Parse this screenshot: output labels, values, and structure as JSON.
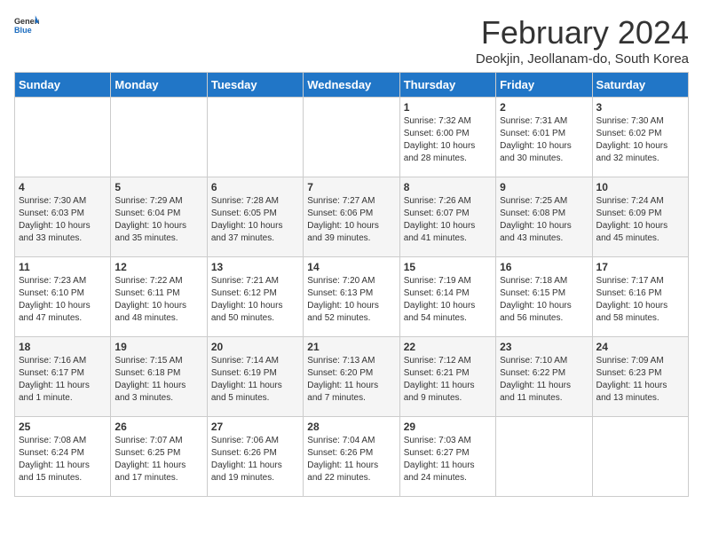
{
  "header": {
    "logo_general": "General",
    "logo_blue": "Blue",
    "month_title": "February 2024",
    "subtitle": "Deokjin, Jeollanam-do, South Korea"
  },
  "weekdays": [
    "Sunday",
    "Monday",
    "Tuesday",
    "Wednesday",
    "Thursday",
    "Friday",
    "Saturday"
  ],
  "weeks": [
    [
      {
        "day": "",
        "info": ""
      },
      {
        "day": "",
        "info": ""
      },
      {
        "day": "",
        "info": ""
      },
      {
        "day": "",
        "info": ""
      },
      {
        "day": "1",
        "info": "Sunrise: 7:32 AM\nSunset: 6:00 PM\nDaylight: 10 hours\nand 28 minutes."
      },
      {
        "day": "2",
        "info": "Sunrise: 7:31 AM\nSunset: 6:01 PM\nDaylight: 10 hours\nand 30 minutes."
      },
      {
        "day": "3",
        "info": "Sunrise: 7:30 AM\nSunset: 6:02 PM\nDaylight: 10 hours\nand 32 minutes."
      }
    ],
    [
      {
        "day": "4",
        "info": "Sunrise: 7:30 AM\nSunset: 6:03 PM\nDaylight: 10 hours\nand 33 minutes."
      },
      {
        "day": "5",
        "info": "Sunrise: 7:29 AM\nSunset: 6:04 PM\nDaylight: 10 hours\nand 35 minutes."
      },
      {
        "day": "6",
        "info": "Sunrise: 7:28 AM\nSunset: 6:05 PM\nDaylight: 10 hours\nand 37 minutes."
      },
      {
        "day": "7",
        "info": "Sunrise: 7:27 AM\nSunset: 6:06 PM\nDaylight: 10 hours\nand 39 minutes."
      },
      {
        "day": "8",
        "info": "Sunrise: 7:26 AM\nSunset: 6:07 PM\nDaylight: 10 hours\nand 41 minutes."
      },
      {
        "day": "9",
        "info": "Sunrise: 7:25 AM\nSunset: 6:08 PM\nDaylight: 10 hours\nand 43 minutes."
      },
      {
        "day": "10",
        "info": "Sunrise: 7:24 AM\nSunset: 6:09 PM\nDaylight: 10 hours\nand 45 minutes."
      }
    ],
    [
      {
        "day": "11",
        "info": "Sunrise: 7:23 AM\nSunset: 6:10 PM\nDaylight: 10 hours\nand 47 minutes."
      },
      {
        "day": "12",
        "info": "Sunrise: 7:22 AM\nSunset: 6:11 PM\nDaylight: 10 hours\nand 48 minutes."
      },
      {
        "day": "13",
        "info": "Sunrise: 7:21 AM\nSunset: 6:12 PM\nDaylight: 10 hours\nand 50 minutes."
      },
      {
        "day": "14",
        "info": "Sunrise: 7:20 AM\nSunset: 6:13 PM\nDaylight: 10 hours\nand 52 minutes."
      },
      {
        "day": "15",
        "info": "Sunrise: 7:19 AM\nSunset: 6:14 PM\nDaylight: 10 hours\nand 54 minutes."
      },
      {
        "day": "16",
        "info": "Sunrise: 7:18 AM\nSunset: 6:15 PM\nDaylight: 10 hours\nand 56 minutes."
      },
      {
        "day": "17",
        "info": "Sunrise: 7:17 AM\nSunset: 6:16 PM\nDaylight: 10 hours\nand 58 minutes."
      }
    ],
    [
      {
        "day": "18",
        "info": "Sunrise: 7:16 AM\nSunset: 6:17 PM\nDaylight: 11 hours\nand 1 minute."
      },
      {
        "day": "19",
        "info": "Sunrise: 7:15 AM\nSunset: 6:18 PM\nDaylight: 11 hours\nand 3 minutes."
      },
      {
        "day": "20",
        "info": "Sunrise: 7:14 AM\nSunset: 6:19 PM\nDaylight: 11 hours\nand 5 minutes."
      },
      {
        "day": "21",
        "info": "Sunrise: 7:13 AM\nSunset: 6:20 PM\nDaylight: 11 hours\nand 7 minutes."
      },
      {
        "day": "22",
        "info": "Sunrise: 7:12 AM\nSunset: 6:21 PM\nDaylight: 11 hours\nand 9 minutes."
      },
      {
        "day": "23",
        "info": "Sunrise: 7:10 AM\nSunset: 6:22 PM\nDaylight: 11 hours\nand 11 minutes."
      },
      {
        "day": "24",
        "info": "Sunrise: 7:09 AM\nSunset: 6:23 PM\nDaylight: 11 hours\nand 13 minutes."
      }
    ],
    [
      {
        "day": "25",
        "info": "Sunrise: 7:08 AM\nSunset: 6:24 PM\nDaylight: 11 hours\nand 15 minutes."
      },
      {
        "day": "26",
        "info": "Sunrise: 7:07 AM\nSunset: 6:25 PM\nDaylight: 11 hours\nand 17 minutes."
      },
      {
        "day": "27",
        "info": "Sunrise: 7:06 AM\nSunset: 6:26 PM\nDaylight: 11 hours\nand 19 minutes."
      },
      {
        "day": "28",
        "info": "Sunrise: 7:04 AM\nSunset: 6:26 PM\nDaylight: 11 hours\nand 22 minutes."
      },
      {
        "day": "29",
        "info": "Sunrise: 7:03 AM\nSunset: 6:27 PM\nDaylight: 11 hours\nand 24 minutes."
      },
      {
        "day": "",
        "info": ""
      },
      {
        "day": "",
        "info": ""
      }
    ]
  ]
}
